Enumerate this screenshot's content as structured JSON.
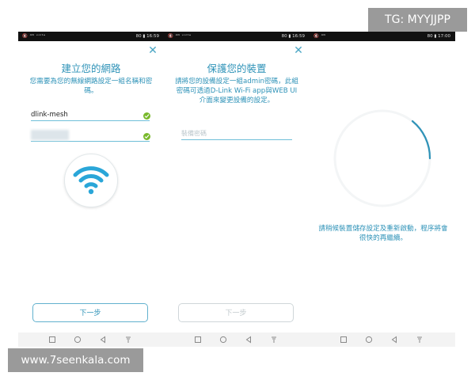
{
  "screens": [
    {
      "status": {
        "left": "🔇 ⁴ᴳ ᵛᵒˡᵗᵉ",
        "right": "80 ▮ 16:59"
      },
      "title": "建立您的網路",
      "description": "您需要為您的無線網路設定一組名稱和密碼。",
      "network_name_value": "dlink-mesh",
      "button_label": "下一步"
    },
    {
      "status": {
        "left": "🔇 ⁴ᴳ ᵛᵒˡᵗᵉ",
        "right": "80 ▮ 16:59"
      },
      "title": "保護您的裝置",
      "description": "請將您的設備設定一組admin密碼，此組密碼可透過D-Link Wi-Fi app與WEB UI介面來變更設備的設定。",
      "password_placeholder": "裝備密碼",
      "button_label": "下一步"
    },
    {
      "status": {
        "left": "🔇 ⁴ᴳ",
        "right": "80 ▮ 17:00"
      },
      "wait_message": "請稍候裝置儲存設定及重新啟動，程序將會很快的再繼續。"
    }
  ],
  "watermarks": {
    "top_right": "TG: MYYJJPP",
    "bottom_left": "www.7seenkala.com"
  },
  "colors": {
    "accent": "#2f93b8",
    "check": "#79b92b"
  },
  "icons": [
    "close-icon",
    "check-icon",
    "wifi-icon",
    "back-icon",
    "home-icon",
    "recent-apps-icon",
    "notification-icon"
  ]
}
